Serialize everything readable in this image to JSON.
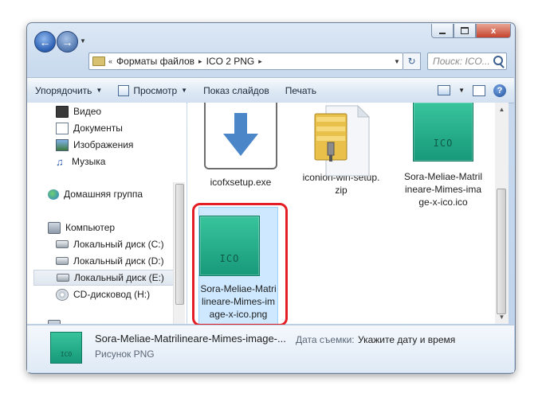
{
  "window": {
    "caption_min": "",
    "caption_max": "",
    "caption_close": "x"
  },
  "address": {
    "crumbs": [
      "Форматы файлов",
      "ICO 2 PNG"
    ],
    "overflow_glyph": "«",
    "separator_glyph": "▸"
  },
  "search": {
    "placeholder": "Поиск: ICO..."
  },
  "toolbar": {
    "organize": "Упорядочить",
    "view": "Просмотр",
    "slideshow": "Показ слайдов",
    "print": "Печать"
  },
  "nav": {
    "libraries": [
      {
        "label": "Видео",
        "icon": "video-icon"
      },
      {
        "label": "Документы",
        "icon": "documents-icon"
      },
      {
        "label": "Изображения",
        "icon": "pictures-icon"
      },
      {
        "label": "Музыка",
        "icon": "music-icon"
      }
    ],
    "homegroup": "Домашняя группа",
    "computer": "Компьютер",
    "drives": [
      {
        "label": "Локальный диск (C:)",
        "icon": "drive-icon"
      },
      {
        "label": "Локальный диск (D:)",
        "icon": "drive-icon"
      },
      {
        "label": "Локальный диск (E:)",
        "icon": "drive-icon",
        "selected": true
      },
      {
        "label": "CD-дисковод (H:)",
        "icon": "cd-drive-icon"
      }
    ]
  },
  "files": [
    {
      "name": "icofxsetup.exe",
      "icon": "installer-download-icon"
    },
    {
      "name": "iconion-win-setup.zip",
      "icon": "zip-archive-icon"
    },
    {
      "name": "Sora-Meliae-Matrilineare-Mimes-image-x-ico.ico",
      "icon": "ico-file-icon",
      "thumb_text": "ICO"
    },
    {
      "name": "Sora-Meliae-Matrilineare-Mimes-image-x-ico.png",
      "icon": "ico-file-icon",
      "thumb_text": "ICO",
      "selected": true
    }
  ],
  "details": {
    "name": "Sora-Meliae-Matrilineare-Mimes-image-...",
    "type": "Рисунок PNG",
    "date_label": "Дата съемки:",
    "date_value": "Укажите дату и время",
    "thumb_text": "ICO"
  },
  "colors": {
    "highlight_frame": "#e31e24",
    "ico_green": "#1fa884",
    "selection": "#cde8ff"
  }
}
